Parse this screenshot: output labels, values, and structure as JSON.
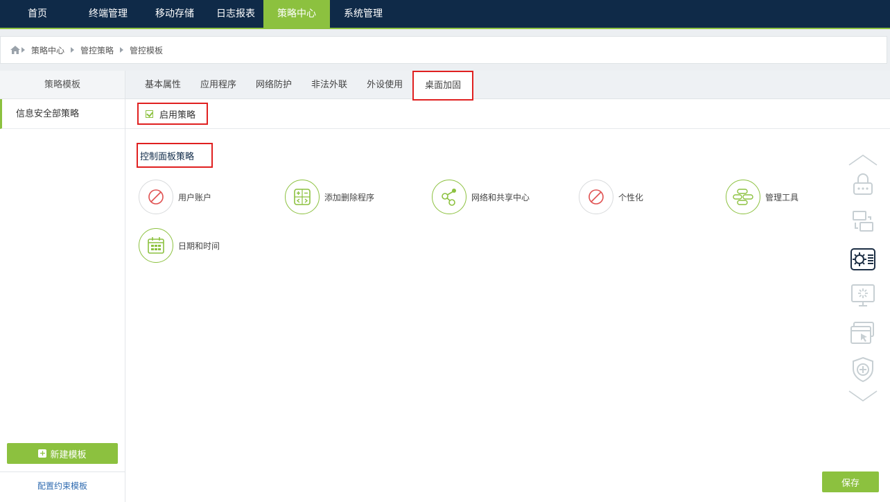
{
  "nav": {
    "items": [
      {
        "label": "首页",
        "active": false
      },
      {
        "label": "终端管理",
        "active": false
      },
      {
        "label": "移动存储",
        "active": false
      },
      {
        "label": "日志报表",
        "active": false
      },
      {
        "label": "策略中心",
        "active": true
      },
      {
        "label": "系统管理",
        "active": false
      }
    ]
  },
  "breadcrumb": {
    "home_icon": "home-icon",
    "items": [
      "策略中心",
      "管控策略",
      "管控模板"
    ]
  },
  "sidebar": {
    "title": "策略模板",
    "items": [
      {
        "label": "信息安全部策略",
        "active": true
      }
    ],
    "new_template_label": "新建模板",
    "config_link_label": "配置约束模板"
  },
  "tabs": [
    {
      "label": "基本属性",
      "active": false
    },
    {
      "label": "应用程序",
      "active": false
    },
    {
      "label": "网络防护",
      "active": false
    },
    {
      "label": "非法外联",
      "active": false
    },
    {
      "label": "外设使用",
      "active": false
    },
    {
      "label": "桌面加固",
      "active": true
    }
  ],
  "enable_policy": {
    "label": "启用策略",
    "checked": true
  },
  "section": {
    "title": "控制面板策略"
  },
  "controls": [
    {
      "label": "用户账户",
      "state": "disabled",
      "icon": "forbidden-icon"
    },
    {
      "label": "添加删除程序",
      "state": "enabled",
      "icon": "calculator-icon"
    },
    {
      "label": "网络和共享中心",
      "state": "enabled",
      "icon": "share-icon"
    },
    {
      "label": "个性化",
      "state": "disabled",
      "icon": "forbidden-icon"
    },
    {
      "label": "管理工具",
      "state": "enabled",
      "icon": "tools-icon"
    },
    {
      "label": "日期和时间",
      "state": "enabled",
      "icon": "calendar-icon"
    }
  ],
  "save_label": "保存",
  "colors": {
    "nav_bg": "#0f2a48",
    "accent": "#8cc13f",
    "highlight": "#e02020",
    "link": "#2f6bb0"
  }
}
